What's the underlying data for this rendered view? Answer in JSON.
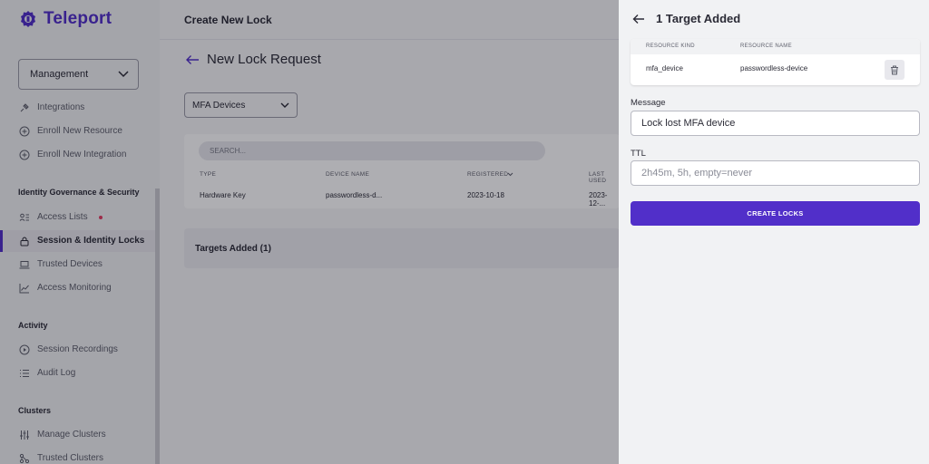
{
  "app": {
    "logo_text": "Teleport",
    "accent": "#512fc9"
  },
  "sidebar": {
    "select_value": "Management",
    "items_top": [
      {
        "label": "Integrations",
        "icon": "plug-icon"
      },
      {
        "label": "Enroll New Resource",
        "icon": "plus-circle-icon"
      },
      {
        "label": "Enroll New Integration",
        "icon": "plus-circle-icon"
      }
    ],
    "section_identity": "Identity Governance & Security",
    "items_identity": [
      {
        "label": "Access Lists",
        "icon": "list-user-icon"
      },
      {
        "label": "Session & Identity Locks",
        "icon": "lock-icon"
      },
      {
        "label": "Trusted Devices",
        "icon": "laptop-icon"
      },
      {
        "label": "Access Monitoring",
        "icon": "chart-icon"
      }
    ],
    "section_activity": "Activity",
    "items_activity": [
      {
        "label": "Session Recordings",
        "icon": "play-circle-icon"
      },
      {
        "label": "Audit Log",
        "icon": "list-icon"
      }
    ],
    "section_clusters": "Clusters",
    "items_clusters": [
      {
        "label": "Manage Clusters",
        "icon": "sliders-icon"
      },
      {
        "label": "Trusted Clusters",
        "icon": "network-icon"
      }
    ]
  },
  "main": {
    "page_title": "Create New Lock",
    "request_title": "New Lock Request",
    "filter_value": "MFA Devices",
    "search_placeholder": "SEARCH...",
    "columns": [
      "TYPE",
      "DEVICE NAME",
      "REGISTERED",
      "LAST USED"
    ],
    "row": [
      "Hardware Key",
      "passwordless-d...",
      "2023-10-18",
      "2023-12-..."
    ],
    "targets_added": "Targets Added (1)"
  },
  "drawer": {
    "title": "1 Target Added",
    "col_kind": "RESOURCE KIND",
    "col_name": "RESOURCE NAME",
    "kind": "mfa_device",
    "name": "passwordless-device",
    "message_label": "Message",
    "message_value": "Lock lost MFA device",
    "ttl_label": "TTL",
    "ttl_placeholder": "2h45m, 5h, empty=never",
    "create_label": "CREATE LOCKS"
  }
}
